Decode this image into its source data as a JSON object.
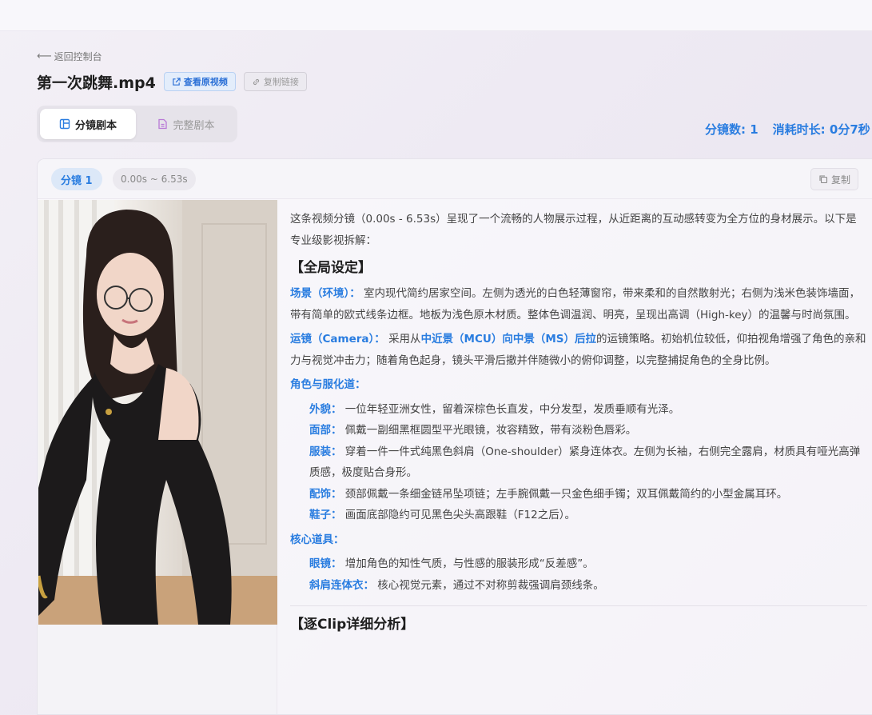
{
  "nav": {
    "back_label": "返回控制台"
  },
  "header": {
    "title": "第一次跳舞.mp4",
    "view_video_label": "查看原视频",
    "copy_link_label": "复制链接"
  },
  "tabs": [
    {
      "label": "分镜剧本",
      "active": true,
      "icon": "layout-icon"
    },
    {
      "label": "完整剧本",
      "active": false,
      "icon": "document-icon"
    }
  ],
  "stats": {
    "shot_count": "分镜数: 1",
    "duration": "消耗时长: 0分7秒"
  },
  "shot": {
    "label": "分镜 1",
    "time_range": "0.00s ~ 6.53s",
    "copy_label": "复制"
  },
  "analysis": {
    "intro": "这条视频分镜（0.00s - 6.53s）呈现了一个流畅的人物展示过程，从近距离的互动感转变为全方位的身材展示。以下是专业级影视拆解：",
    "global_heading": "【全局设定】",
    "scene_label": "场景（环境）：",
    "scene_text": "室内现代简约居家空间。左侧为透光的白色轻薄窗帘，带来柔和的自然散射光；右侧为浅米色装饰墙面，带有简单的欧式线条边框。地板为浅色原木材质。整体色调温润、明亮，呈现出高调（High-key）的温馨与时尚氛围。",
    "camera_label": "运镜（Camera）：",
    "camera_pre": "采用从",
    "camera_hl": "中近景（MCU）向中景（MS）后拉",
    "camera_post": "的运镜策略。初始机位较低，仰拍视角增强了角色的亲和力与视觉冲击力；随着角色起身，镜头平滑后撤并伴随微小的俯仰调整，以完整捕捉角色的全身比例。",
    "character_label": "角色与服化道：",
    "character_items": [
      {
        "label": "外貌：",
        "text": "一位年轻亚洲女性，留着深棕色长直发，中分发型，发质垂顺有光泽。"
      },
      {
        "label": "面部：",
        "text": "佩戴一副细黑框圆型平光眼镜，妆容精致，带有淡粉色唇彩。"
      },
      {
        "label": "服装：",
        "text": "穿着一件一件式纯黑色斜肩（One-shoulder）紧身连体衣。左侧为长袖，右侧完全露肩，材质具有哑光高弹质感，极度贴合身形。"
      },
      {
        "label": "配饰：",
        "text": "颈部佩戴一条细金链吊坠项链；左手腕佩戴一只金色细手镯；双耳佩戴简约的小型金属耳环。"
      },
      {
        "label": "鞋子：",
        "text": "画面底部隐约可见黑色尖头高跟鞋（F12之后）。"
      }
    ],
    "props_label": "核心道具：",
    "props_items": [
      {
        "label": "眼镜：",
        "text": "增加角色的知性气质，与性感的服装形成“反差感”。"
      },
      {
        "label": "斜肩连体衣：",
        "text": "核心视觉元素，通过不对称剪裁强调肩颈线条。"
      }
    ],
    "clip_heading": "【逐Clip详细分析】"
  }
}
